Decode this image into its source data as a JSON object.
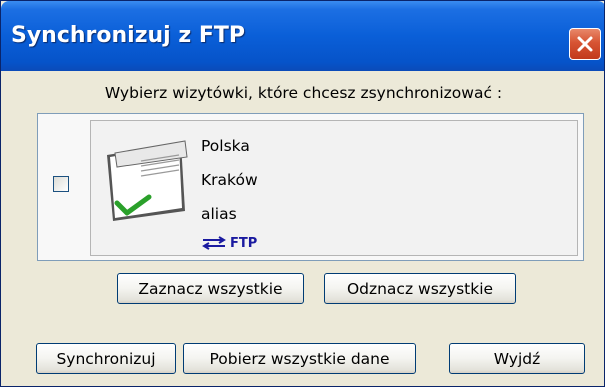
{
  "window": {
    "title": "Synchronizuj z FTP",
    "close_icon": "close-icon"
  },
  "prompt": "Wybierz wizytówki, które chcesz zsynchronizować :",
  "cards": [
    {
      "checked": false,
      "line1": "Polska",
      "line2": "Kraków",
      "line3": "alias",
      "ftp_label": "FTP",
      "icon": "business-card-icon",
      "ftp_icon": "sync-arrows-icon"
    }
  ],
  "buttons": {
    "select_all": "Zaznacz wszystkie",
    "deselect_all": "Odznacz wszystkie",
    "synchronize": "Synchronizuj",
    "download_all": "Pobierz wszystkie dane",
    "exit": "Wyjdź"
  },
  "colors": {
    "titlebar": "#0a5fd8",
    "close": "#d75433",
    "window_bg": "#ece9d8",
    "ftp_text": "#1a1aa0",
    "check_green": "#2aa02a"
  }
}
